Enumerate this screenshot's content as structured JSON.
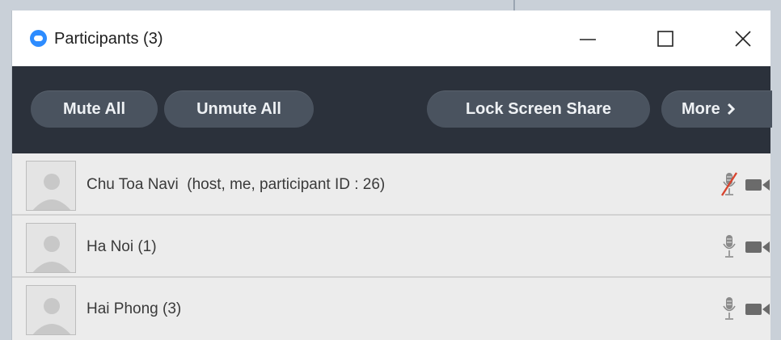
{
  "window": {
    "title": "Participants (3)",
    "minimize_icon": "minimize-icon",
    "maximize_icon": "maximize-icon",
    "close_icon": "close-icon",
    "app_icon": "zoom-logo-icon",
    "accent_color": "#2d8cff"
  },
  "toolbar": {
    "mute_all_label": "Mute All",
    "unmute_all_label": "Unmute All",
    "lock_screen_share_label": "Lock Screen Share",
    "more_label": "More",
    "more_icon": "chevron-right-icon",
    "background_color": "#2b313b",
    "button_color": "#4a535f"
  },
  "participants": [
    {
      "name": "Chu Toa Navi  (host, me, participant ID : 26)",
      "mic_state": "muted",
      "mic_icon": "mic-muted-icon",
      "video_icon": "video-camera-icon"
    },
    {
      "name": "Ha Noi (1)",
      "mic_state": "on",
      "mic_icon": "mic-icon",
      "video_icon": "video-camera-icon"
    },
    {
      "name": "Hai Phong (3)",
      "mic_state": "on",
      "mic_icon": "mic-icon",
      "video_icon": "video-camera-icon"
    }
  ]
}
